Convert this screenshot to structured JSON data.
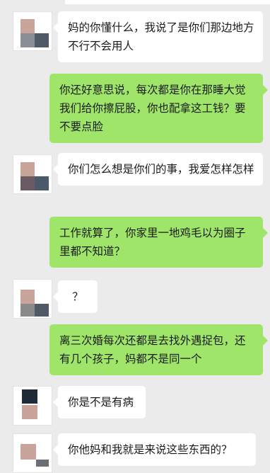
{
  "colors": {
    "background": "#ebebeb",
    "incoming_bubble": "#ffffff",
    "outgoing_bubble": "#9ee56a"
  },
  "messages": [
    {
      "from": "other",
      "text": "妈的你懂什么，我说了是你们那边地方不行不会用人"
    },
    {
      "from": "self",
      "text": "你还好意思说，每次都是你在那睡大觉我们给你擦屁股，你也配拿这工钱？要不要点脸"
    },
    {
      "from": "other",
      "text": "你们怎么想是你们的事，我爱怎样怎样"
    },
    {
      "from": "self",
      "text": "工作就算了，你家里一地鸡毛以为圈子里都不知道？"
    },
    {
      "from": "other",
      "text": "？"
    },
    {
      "from": "self",
      "text": "离三次婚每次还都是去找外遇捉包，还有几个孩子，妈都不是同一个"
    },
    {
      "from": "other",
      "text": "你是不是有病"
    },
    {
      "from": "other",
      "text": "你他妈和我就是来说这些东西的？"
    }
  ]
}
